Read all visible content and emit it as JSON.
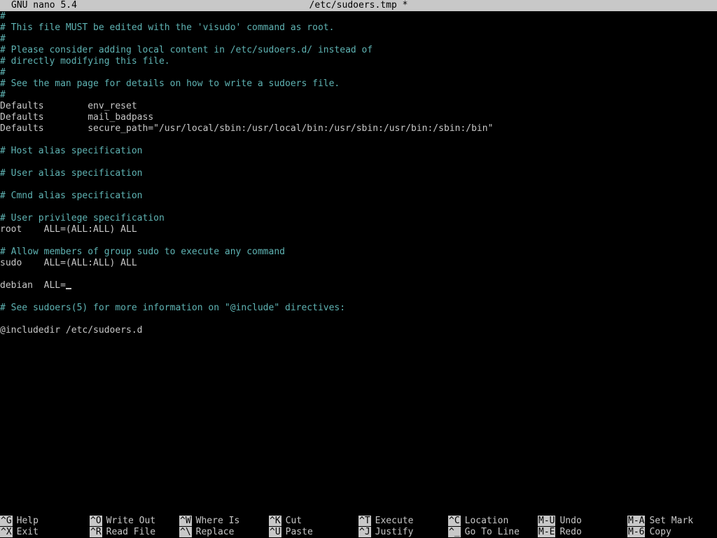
{
  "titlebar": {
    "app_name": "GNU nano 5.4",
    "file_name": "/etc/sudoers.tmp *"
  },
  "editor": {
    "lines": [
      {
        "text": "#",
        "kind": "comment"
      },
      {
        "text": "# This file MUST be edited with the 'visudo' command as root.",
        "kind": "comment"
      },
      {
        "text": "#",
        "kind": "comment"
      },
      {
        "text": "# Please consider adding local content in /etc/sudoers.d/ instead of",
        "kind": "comment"
      },
      {
        "text": "# directly modifying this file.",
        "kind": "comment"
      },
      {
        "text": "#",
        "kind": "comment"
      },
      {
        "text": "# See the man page for details on how to write a sudoers file.",
        "kind": "comment"
      },
      {
        "text": "#",
        "kind": "comment"
      },
      {
        "text": "Defaults        env_reset",
        "kind": "normal"
      },
      {
        "text": "Defaults        mail_badpass",
        "kind": "normal"
      },
      {
        "text": "Defaults        secure_path=\"/usr/local/sbin:/usr/local/bin:/usr/sbin:/usr/bin:/sbin:/bin\"",
        "kind": "normal"
      },
      {
        "text": "",
        "kind": "normal"
      },
      {
        "text": "# Host alias specification",
        "kind": "comment"
      },
      {
        "text": "",
        "kind": "normal"
      },
      {
        "text": "# User alias specification",
        "kind": "comment"
      },
      {
        "text": "",
        "kind": "normal"
      },
      {
        "text": "# Cmnd alias specification",
        "kind": "comment"
      },
      {
        "text": "",
        "kind": "normal"
      },
      {
        "text": "# User privilege specification",
        "kind": "comment"
      },
      {
        "text": "root    ALL=(ALL:ALL) ALL",
        "kind": "normal"
      },
      {
        "text": "",
        "kind": "normal"
      },
      {
        "text": "# Allow members of group sudo to execute any command",
        "kind": "comment"
      },
      {
        "text": "sudo    ALL=(ALL:ALL) ALL",
        "kind": "normal"
      },
      {
        "text": "",
        "kind": "normal"
      },
      {
        "text": "debian  ALL=",
        "kind": "normal",
        "cursor": true
      },
      {
        "text": "",
        "kind": "normal"
      },
      {
        "text": "# See sudoers(5) for more information on \"@include\" directives:",
        "kind": "comment"
      },
      {
        "text": "",
        "kind": "normal"
      },
      {
        "text": "@includedir /etc/sudoers.d",
        "kind": "normal"
      }
    ]
  },
  "shortcuts": [
    {
      "key": "^G",
      "label": "Help"
    },
    {
      "key": "^X",
      "label": "Exit"
    },
    {
      "key": "^O",
      "label": "Write Out"
    },
    {
      "key": "^R",
      "label": "Read File"
    },
    {
      "key": "^W",
      "label": "Where Is"
    },
    {
      "key": "^\\",
      "label": "Replace"
    },
    {
      "key": "^K",
      "label": "Cut"
    },
    {
      "key": "^U",
      "label": "Paste"
    },
    {
      "key": "^T",
      "label": "Execute"
    },
    {
      "key": "^J",
      "label": "Justify"
    },
    {
      "key": "^C",
      "label": "Location"
    },
    {
      "key": "^_",
      "label": "Go To Line"
    },
    {
      "key": "M-U",
      "label": "Undo"
    },
    {
      "key": "M-E",
      "label": "Redo"
    },
    {
      "key": "M-A",
      "label": "Set Mark"
    },
    {
      "key": "M-6",
      "label": "Copy"
    }
  ],
  "colors": {
    "background": "#000000",
    "text": "#c8c8c8",
    "comment": "#5fb4b4",
    "titlebar": "#c8c8c8"
  }
}
